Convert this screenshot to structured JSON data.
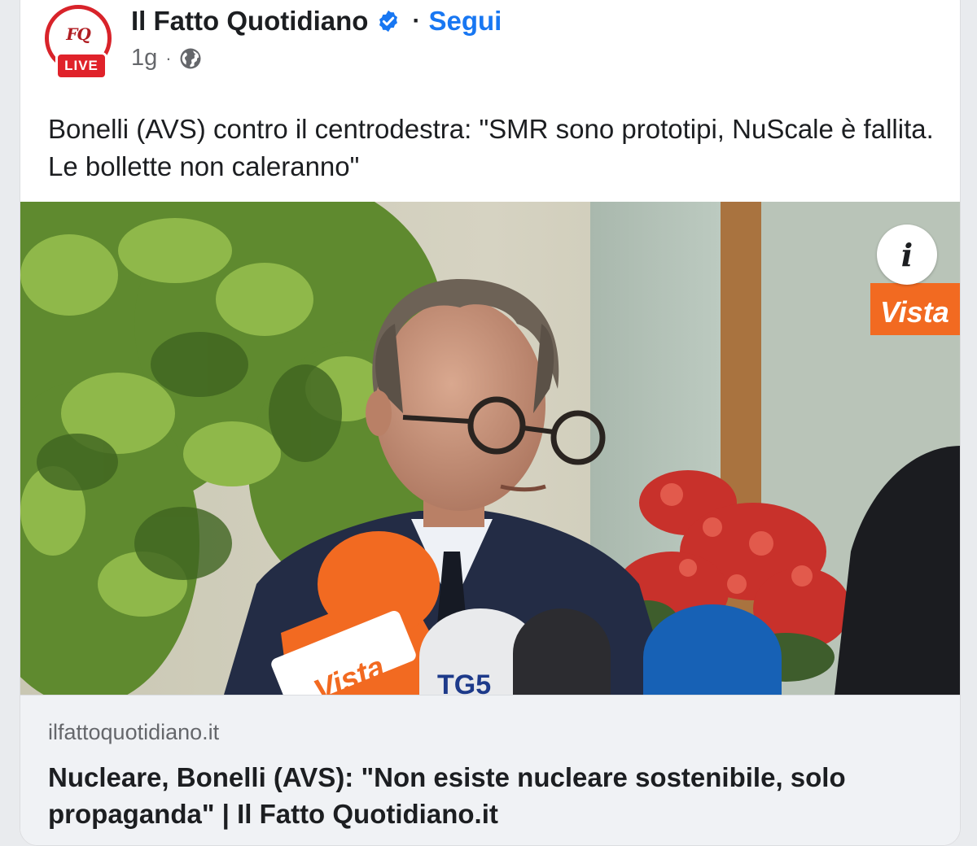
{
  "post": {
    "page_name": "Il Fatto Quotidiano",
    "follow_label": "Segui",
    "separator": "·",
    "time_ago": "1g",
    "meta_separator": "·",
    "audience_icon": "globe-icon",
    "avatar": {
      "logo_text": "FQ",
      "badge_label": "LIVE"
    },
    "verified_icon": "verified-badge-icon",
    "caption": "Bonelli (AVS) contro il centrodestra: \"SMR sono prototipi, NuScale è fallita. Le bollette non caleranno\""
  },
  "link_preview": {
    "info_icon_label": "i",
    "image_watermark": "Vista",
    "mic_labels": [
      "Vista",
      "TG5"
    ],
    "domain": "ilfattoquotidiano.it",
    "title": "Nucleare, Bonelli (AVS): \"Non esiste nucleare sostenibile, solo propaganda\" | Il Fatto Quotidiano.it"
  },
  "colors": {
    "accent": "#1877f2",
    "live_red": "#e0222a",
    "text_primary": "#1c1e21",
    "text_secondary": "#65676b",
    "link_footer_bg": "#f0f2f5",
    "vista_orange": "#f26a21"
  }
}
